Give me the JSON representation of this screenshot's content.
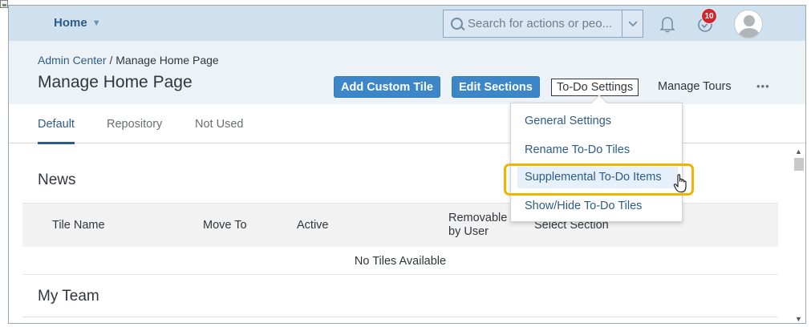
{
  "shell": {
    "home_label": "Home",
    "search_placeholder": "Search for actions or peo...",
    "notification_count": "10"
  },
  "header": {
    "breadcrumb_link": "Admin Center",
    "breadcrumb_separator": " / ",
    "breadcrumb_current": "Manage Home Page",
    "title": "Manage Home Page",
    "buttons": {
      "add_custom_tile": "Add Custom Tile",
      "edit_sections": "Edit Sections",
      "todo_settings": "To-Do Settings",
      "manage_tours": "Manage Tours",
      "more": "•••"
    }
  },
  "tabs": [
    {
      "label": "Default",
      "active": true
    },
    {
      "label": "Repository",
      "active": false
    },
    {
      "label": "Not Used",
      "active": false
    }
  ],
  "sections": {
    "news": "News",
    "my_team": "My Team"
  },
  "table": {
    "columns": [
      "Tile Name",
      "Move To",
      "Active",
      "Removable by User",
      "Select Section"
    ],
    "removable_line1": "Removable",
    "removable_line2": "by User",
    "empty_message": "No Tiles Available"
  },
  "todo_menu": {
    "items": [
      "General Settings",
      "Rename To-Do Tiles",
      "Supplemental To-Do Items",
      "Show/Hide To-Do Tiles"
    ],
    "highlighted_item": "Supplemental To-Do Items"
  },
  "colors": {
    "shell_bg": "#cfe0ef",
    "header_bg": "#edf2f7",
    "primary_button": "#3d86c8",
    "link": "#2d5c88",
    "highlight_border": "#f0b400",
    "badge": "#d2262f"
  }
}
